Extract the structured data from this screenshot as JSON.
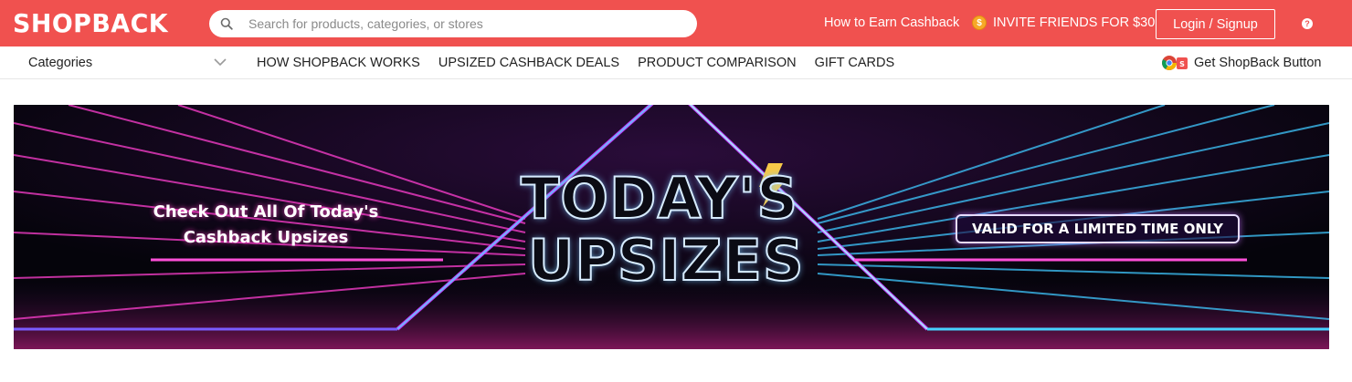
{
  "header": {
    "logo_text": "SHOPBACK",
    "search_placeholder": "Search for products, categories, or stores",
    "earn_link": "How to Earn Cashback",
    "invite_label": "INVITE FRIENDS FOR $30",
    "coin_symbol": "$",
    "login_label": "Login / Signup",
    "help_symbol": "?"
  },
  "nav": {
    "categories_label": "Categories",
    "links": [
      "HOW SHOPBACK WORKS",
      "UPSIZED CASHBACK DEALS",
      "PRODUCT COMPARISON",
      "GIFT CARDS"
    ],
    "shopback_button_label": "Get ShopBack Button"
  },
  "banner": {
    "left_line1": "Check Out All Of Today's",
    "left_line2": "Cashback Upsizes",
    "title_line1": "TODAY'S",
    "title_line2": "UPSIZES",
    "badge": "VALID FOR A LIMITED TIME ONLY"
  },
  "colors": {
    "brand_red": "#f0514f",
    "banner_pink": "#ff3fd0",
    "banner_cyan": "#3fc8ff"
  },
  "icons": [
    "search-icon",
    "coin-icon",
    "help-icon",
    "chevron-down-icon",
    "chrome-icon",
    "lightning-icon"
  ]
}
